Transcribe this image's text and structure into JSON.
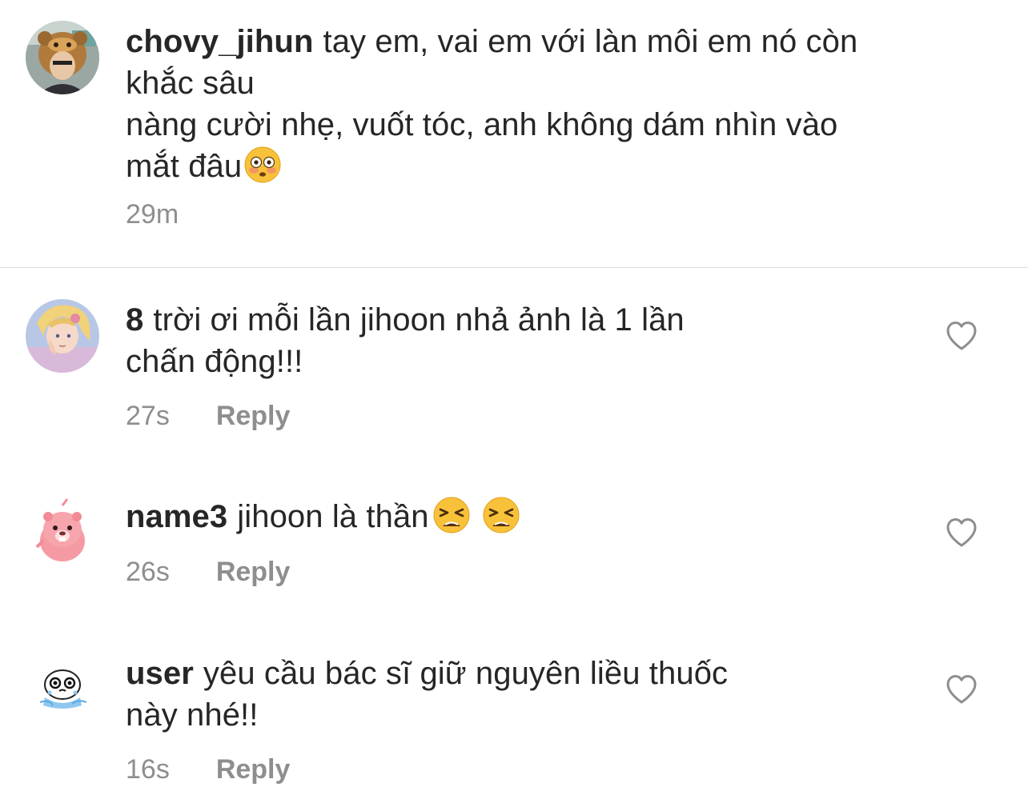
{
  "caption": {
    "username": "chovy_jihun",
    "lines": [
      "tay em, vai em với làn môi em nó còn",
      "khắc sâu",
      "nàng cười nhẹ, vuốt tóc, anh không dám nhìn vào",
      "mắt đâu"
    ],
    "emoji": "flushed-face",
    "timestamp": "29m"
  },
  "comments": [
    {
      "username": "8",
      "lines": [
        "trời ơi mỗi lần jihoon nhả ảnh là 1 lần",
        "chấn động!!!"
      ],
      "timestamp": "27s",
      "reply_label": "Reply"
    },
    {
      "username": "name3",
      "lines": [
        "jihoon là thần"
      ],
      "emojis": [
        "tired-face",
        "tired-face"
      ],
      "timestamp": "26s",
      "reply_label": "Reply"
    },
    {
      "username": "user",
      "lines": [
        "yêu cầu bác sĩ giữ nguyên liều thuốc",
        "này nhé!!"
      ],
      "timestamp": "16s",
      "reply_label": "Reply"
    }
  ],
  "icons": {
    "like": "heart-outline-icon"
  },
  "colors": {
    "text": "#262626",
    "meta": "#8e8e8e",
    "divider": "#dbdbdb",
    "emoji": "#f7c23a"
  }
}
